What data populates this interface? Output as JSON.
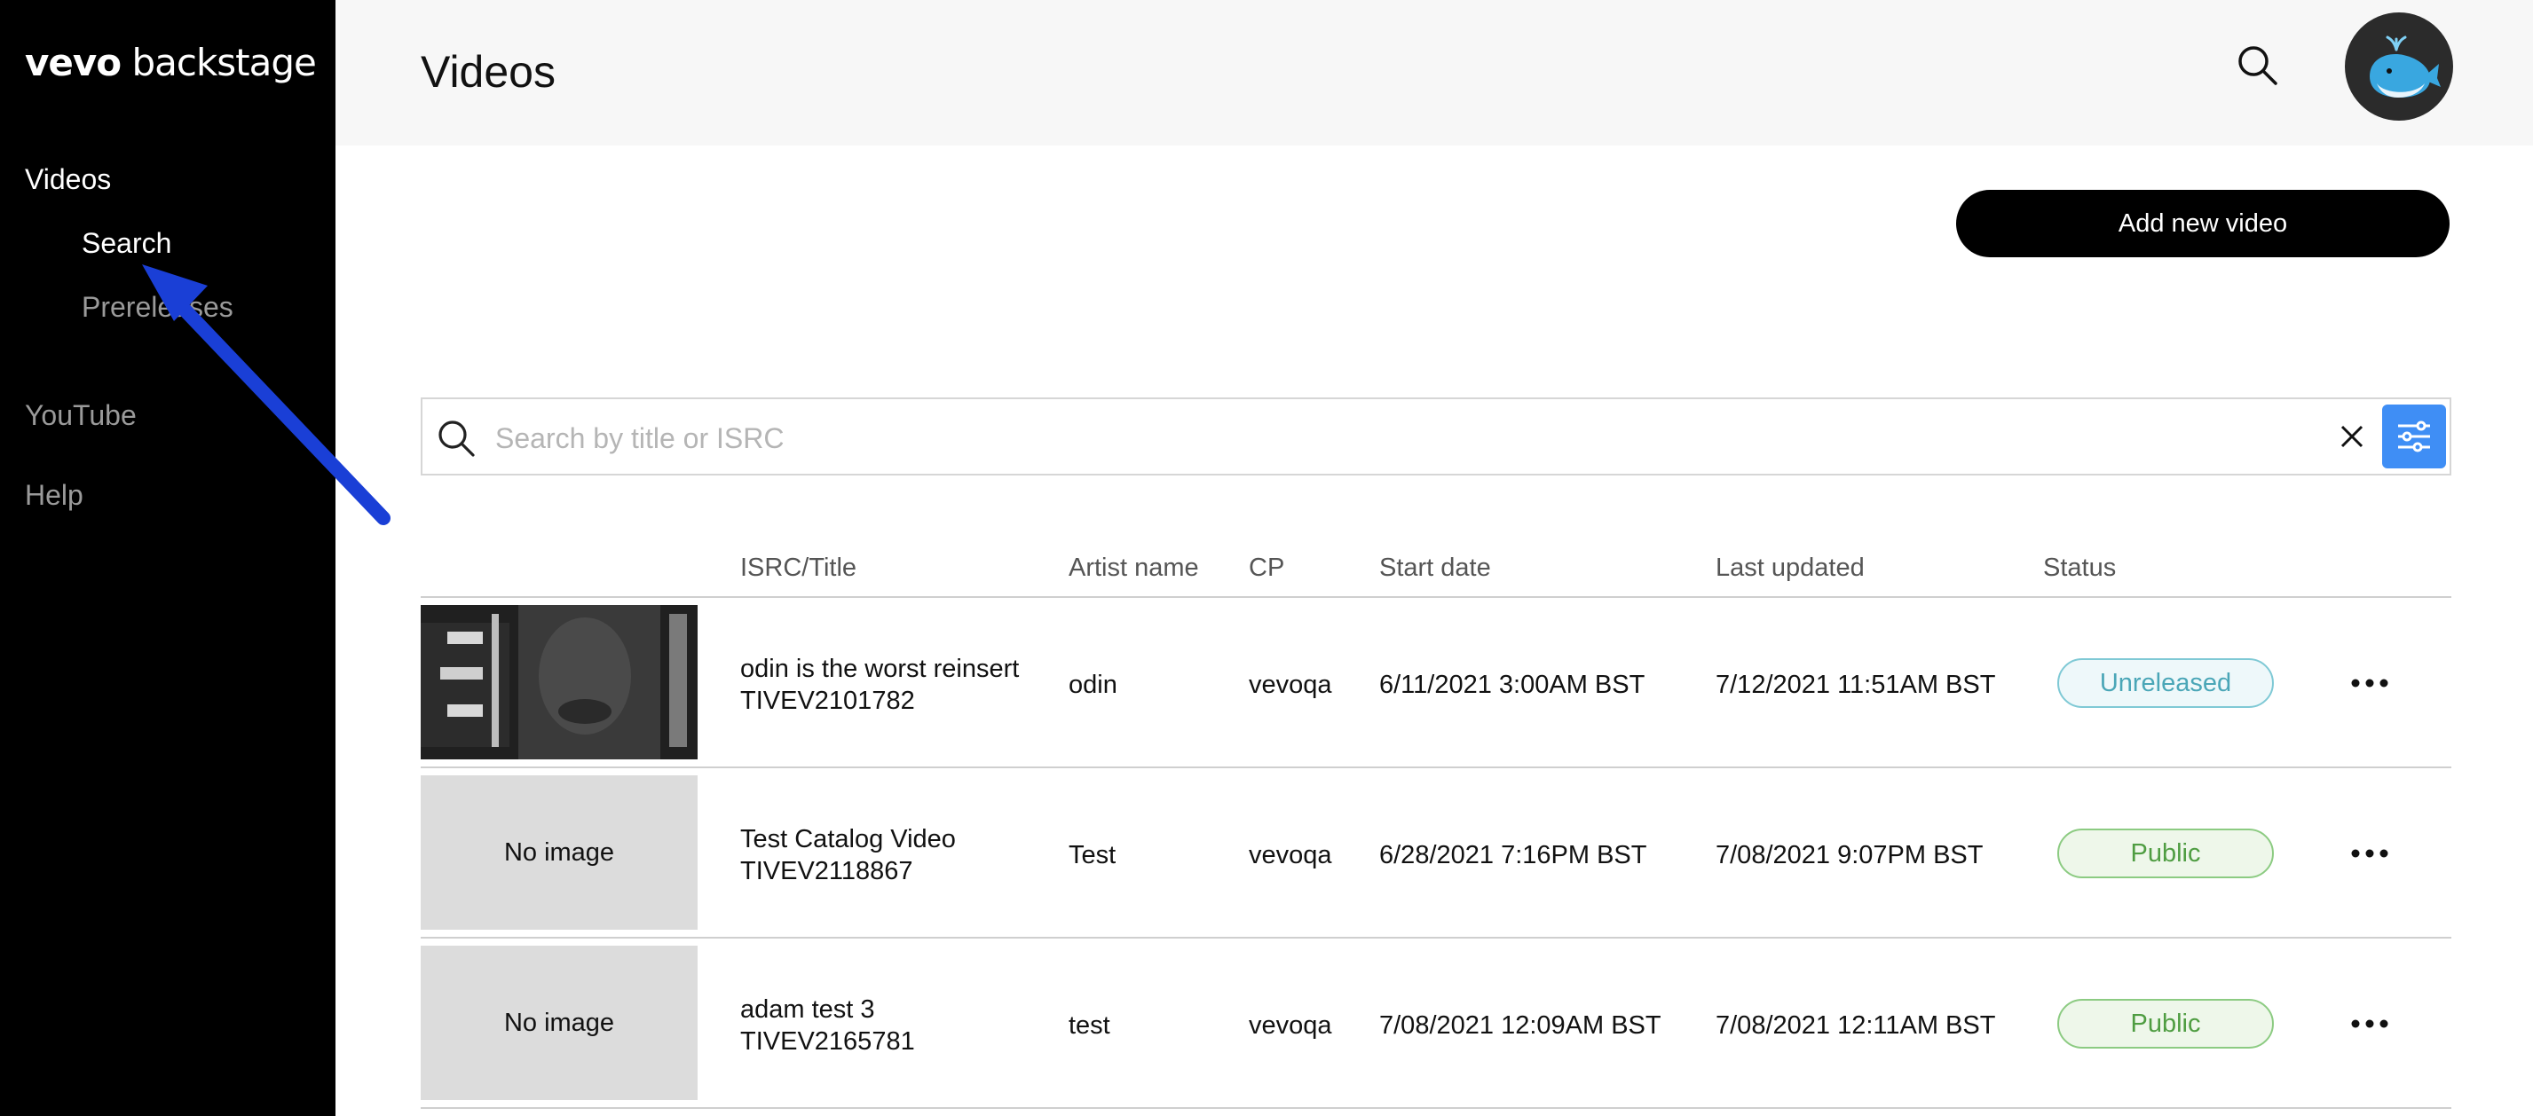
{
  "sidebar": {
    "logo_bold": "vevo",
    "logo_rest": " backstage",
    "items": {
      "videos": "Videos",
      "search": "Search",
      "prereleases": "Prereleases",
      "youtube": "YouTube",
      "help": "Help"
    }
  },
  "header": {
    "title": "Videos"
  },
  "actions": {
    "add_label": "Add new video"
  },
  "search": {
    "placeholder": "Search by title or ISRC",
    "value": ""
  },
  "table": {
    "columns": [
      "ISRC/Title",
      "Artist name",
      "CP",
      "Start date",
      "Last updated",
      "Status"
    ],
    "no_image_label": "No image",
    "rows": [
      {
        "title": "odin is the worst reinsert",
        "isrc": "TIVEV2101782",
        "artist": "odin",
        "cp": "vevoqa",
        "start_date": "6/11/2021 3:00AM BST",
        "last_updated": "7/12/2021 11:51AM BST",
        "status": "Unreleased",
        "has_image": true
      },
      {
        "title": "Test Catalog Video",
        "isrc": "TIVEV2118867",
        "artist": "Test",
        "cp": "vevoqa",
        "start_date": "6/28/2021 7:16PM BST",
        "last_updated": "7/08/2021 9:07PM BST",
        "status": "Public",
        "has_image": false
      },
      {
        "title": "adam test 3",
        "isrc": "TIVEV2165781",
        "artist": "test",
        "cp": "vevoqa",
        "start_date": "7/08/2021 12:09AM BST",
        "last_updated": "7/08/2021 12:11AM BST",
        "status": "Public",
        "has_image": false
      }
    ]
  },
  "colors": {
    "sidebar_bg": "#000000",
    "accent_blue": "#3f8ef5",
    "unreleased": "#4aa6b7",
    "public": "#4f9d42",
    "annotation_arrow": "#1a3fd6"
  }
}
